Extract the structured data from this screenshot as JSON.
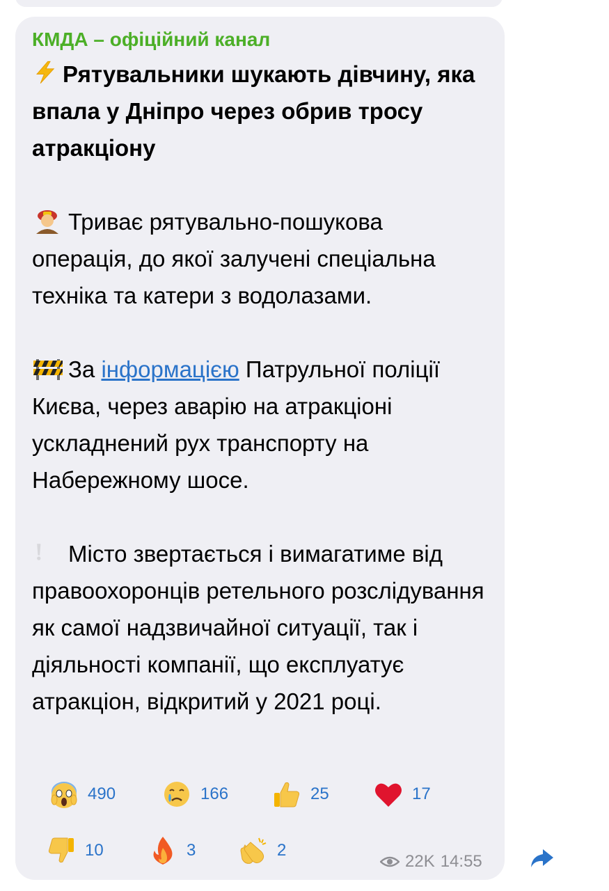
{
  "message": {
    "channel_name": "КМДА – офіційний канал",
    "headline_emoji": "lightning-emoji",
    "headline": "Рятувальники шукають дівчину, яка впала у Дніпро через обрив тросу атракціону",
    "paragraph1": {
      "emoji": "firefighter-emoji",
      "text": "Триває рятувально-пошукова операція, до якої залучені спеціальна техніка та катери з водолазами."
    },
    "paragraph2": {
      "emoji": "construction-barrier-emoji",
      "prefix": "За ",
      "link_text": "інформацією",
      "suffix": " Патрульної поліції Києва, через аварію на атракціоні ускладнений рух транспорту на Набережному шосе."
    },
    "paragraph3": {
      "emoji": "exclamation-emoji",
      "text": "Місто звертається і вимагатиме від правоохоронців ретельного розслідування як самої надзвичайної ситуації, так і діяльності компанії, що експлуатує атракціон, відкритий у 2021 році."
    }
  },
  "reactions": [
    {
      "emoji": "scream-face-emoji",
      "count": "490"
    },
    {
      "emoji": "crying-face-emoji",
      "count": "166"
    },
    {
      "emoji": "thumbs-up-emoji",
      "count": "25"
    },
    {
      "emoji": "red-heart-emoji",
      "count": "17"
    },
    {
      "emoji": "thumbs-down-emoji",
      "count": "10"
    },
    {
      "emoji": "fire-emoji",
      "count": "3"
    },
    {
      "emoji": "clapping-hands-emoji",
      "count": "2"
    }
  ],
  "meta": {
    "views": "22K",
    "time": "14:55"
  },
  "colors": {
    "bubble": "#efeff4",
    "channel_name": "#4caf27",
    "link": "#2a73c9",
    "meta": "#8e8e93"
  }
}
